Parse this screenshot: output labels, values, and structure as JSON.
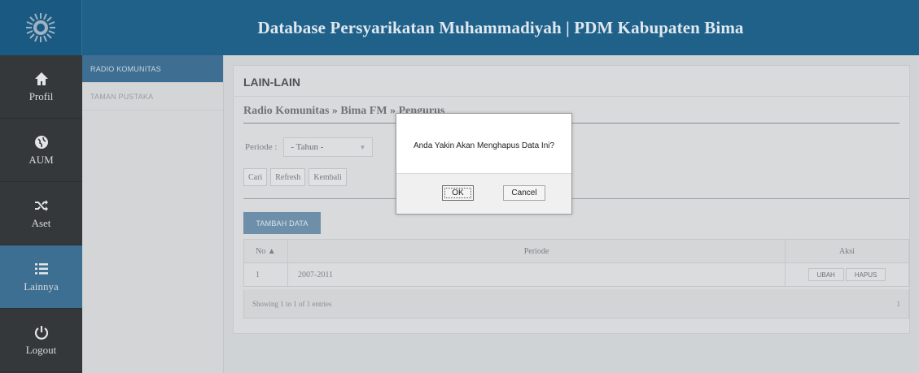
{
  "app": {
    "title": "Database Persyarikatan Muhammadiyah | PDM Kabupaten Bima"
  },
  "nav": [
    {
      "label": "Profil",
      "icon": "home-icon",
      "active": false
    },
    {
      "label": "AUM",
      "icon": "globe-icon",
      "active": false
    },
    {
      "label": "Aset",
      "icon": "shuffle-icon",
      "active": false
    },
    {
      "label": "Lainnya",
      "icon": "list-icon",
      "active": true
    },
    {
      "label": "Logout",
      "icon": "power-icon",
      "active": false
    }
  ],
  "subnav": [
    {
      "label": "RADIO KOMUNITAS",
      "active": true
    },
    {
      "label": "TAMAN PUSTAKA",
      "active": false
    }
  ],
  "panel": {
    "title": "LAIN-LAIN",
    "breadcrumb": "Radio Komunitas » Bima FM » Pengurus"
  },
  "filter": {
    "label": "Periode :",
    "select_value": "- Tahun -"
  },
  "buttons": {
    "cari": "Cari",
    "refresh": "Refresh",
    "kembali": "Kembali"
  },
  "add_button": "TAMBAH DATA",
  "table": {
    "headers": {
      "no": "No",
      "periode": "Periode",
      "aksi": "Aksi"
    },
    "rows": [
      {
        "no": "1",
        "periode": "2007-2011",
        "ubah": "UBAH",
        "hapus": "HAPUS"
      }
    ],
    "footer_info": "Showing 1 to 1 of 1 entries",
    "page": "1"
  },
  "modal": {
    "message": "Anda Yakin Akan Menghapus Data Ini?",
    "ok": "OK",
    "cancel": "Cancel"
  },
  "colors": {
    "header": "#20618a",
    "nav": "#35383b",
    "nav_active": "#3d6f92",
    "accent": "#6e8fa9"
  }
}
